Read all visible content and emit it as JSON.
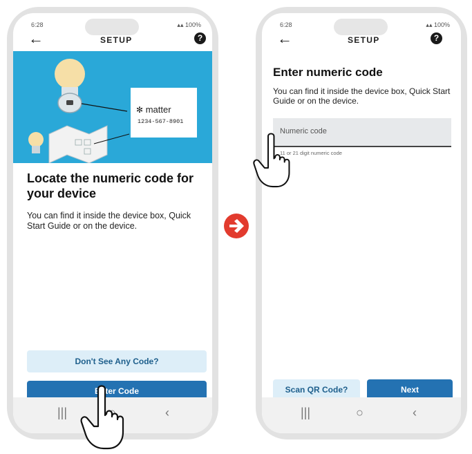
{
  "left_screen": {
    "status_time": "6:28",
    "status_icons": "100%",
    "header_title": "SETUP",
    "help_symbol": "?",
    "matter_brand": "matter",
    "matter_code": "1234-567-8901",
    "heading": "Locate the numeric code for your device",
    "body": "You can find it inside the device box, Quick Start Guide or on the device.",
    "secondary_button": "Don't See Any Code?",
    "primary_button": "Enter Code"
  },
  "right_screen": {
    "status_time": "6:28",
    "status_icons": "100%",
    "header_title": "SETUP",
    "help_symbol": "?",
    "heading": "Enter numeric code",
    "body": "You can find it inside the device box, Quick Start Guide or on the device.",
    "input_placeholder": "Numeric code",
    "helper_text": "11 or 21 digit numeric code",
    "scan_button": "Scan QR Code?",
    "next_button": "Next"
  },
  "colors": {
    "banner": "#2aa8d8",
    "primary": "#2472b2",
    "secondary_bg": "#ddeef8",
    "arrow": "#e23b2e",
    "input_bg": "#e7e9eb"
  }
}
